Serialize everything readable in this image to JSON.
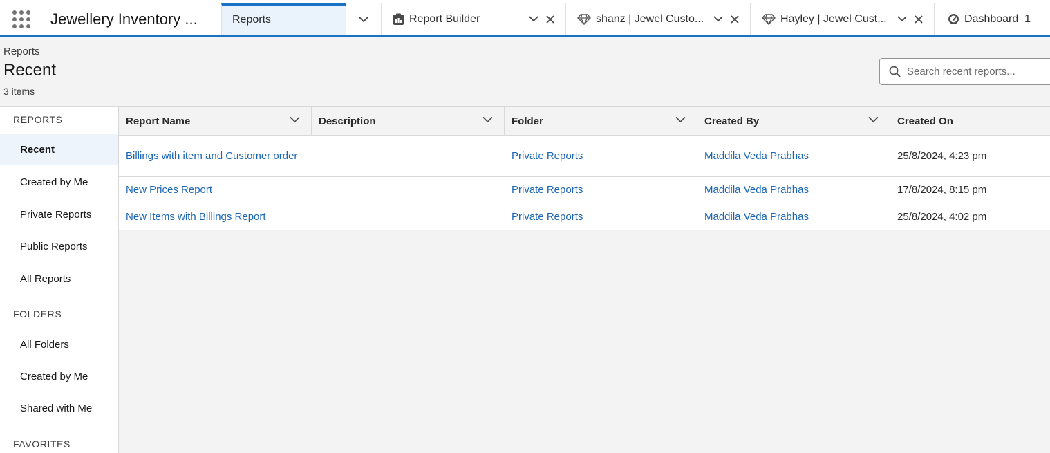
{
  "app": {
    "name": "Jewellery Inventory ..."
  },
  "tabs": [
    {
      "label": "Reports",
      "icon": "none",
      "active": true
    },
    {
      "label": "Report Builder",
      "icon": "report-builder-icon"
    },
    {
      "label": "shanz | Jewel Custo...",
      "icon": "diamond-icon"
    },
    {
      "label": "Hayley | Jewel Cust...",
      "icon": "diamond-icon"
    },
    {
      "label": "Dashboard_1",
      "icon": "dashboard-gauge-icon"
    }
  ],
  "header": {
    "breadcrumb": "Reports",
    "title": "Recent",
    "count": "3 items",
    "search_placeholder": "Search recent reports..."
  },
  "sidebar": {
    "reports_section": "REPORTS",
    "reports_items": [
      "Recent",
      "Created by Me",
      "Private Reports",
      "Public Reports",
      "All Reports"
    ],
    "folders_section": "FOLDERS",
    "folders_items": [
      "All Folders",
      "Created by Me",
      "Shared with Me"
    ],
    "favorites_section": "FAVORITES"
  },
  "table": {
    "columns": [
      "Report Name",
      "Description",
      "Folder",
      "Created By",
      "Created On"
    ],
    "rows": [
      {
        "name": "Billings with item and Customer order",
        "description": "",
        "folder": "Private Reports",
        "created_by": "Maddila Veda Prabhas",
        "created_on": "25/8/2024, 4:23 pm"
      },
      {
        "name": "New Prices Report",
        "description": "",
        "folder": "Private Reports",
        "created_by": "Maddila Veda Prabhas",
        "created_on": "17/8/2024, 8:15 pm"
      },
      {
        "name": "New Items with Billings Report",
        "description": "",
        "folder": "Private Reports",
        "created_by": "Maddila Veda Prabhas",
        "created_on": "25/8/2024, 4:02 pm"
      }
    ]
  },
  "colors": {
    "accent": "#1b72c4",
    "link": "#1b66b3",
    "active_bg": "#eef4fb"
  }
}
